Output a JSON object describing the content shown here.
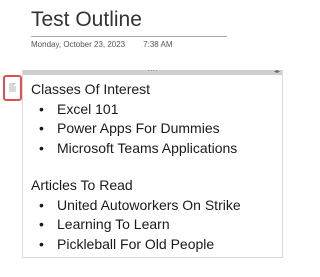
{
  "page": {
    "title": "Test Outline",
    "date": "Monday, October 23, 2023",
    "time": "7:38 AM"
  },
  "container": {
    "move_handle_glyph": "····",
    "resize_glyph": "◂▸"
  },
  "outline": {
    "groups": [
      {
        "heading": "Classes Of Interest",
        "items": [
          "Excel 101",
          "Power Apps For Dummies",
          "Microsoft Teams Applications"
        ]
      },
      {
        "heading": "Articles To Read",
        "items": [
          "United Autoworkers On Strike",
          "Learning To Learn",
          "Pickleball For Old People"
        ]
      }
    ],
    "bullet": "•"
  },
  "colors": {
    "highlight_border": "#e05050",
    "container_bar": "#cfcfcf",
    "title_text": "#333333"
  },
  "icons": {
    "paragraph_handle": "page-handle-icon"
  }
}
